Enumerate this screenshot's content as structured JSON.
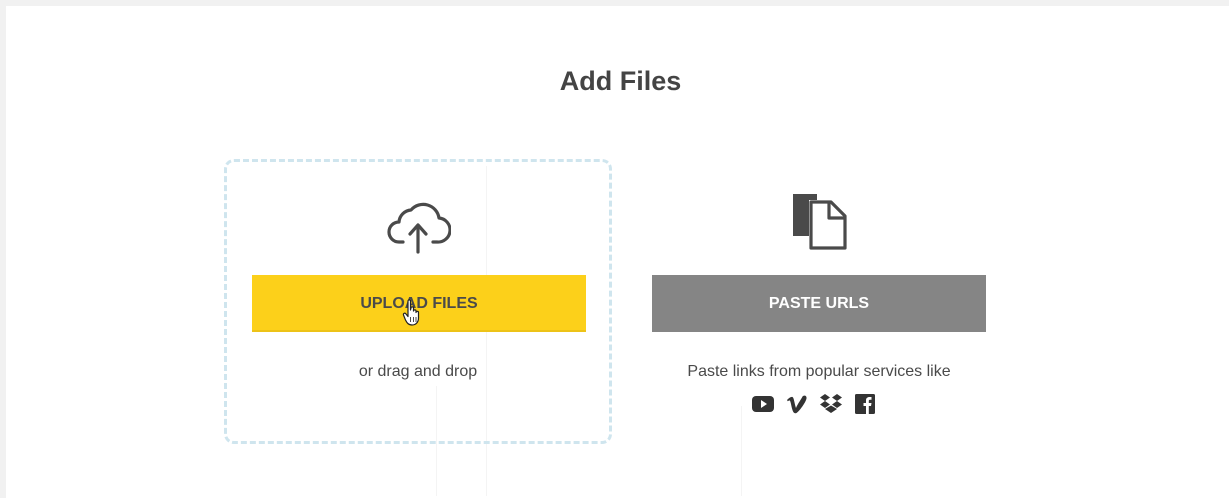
{
  "header": {
    "title": "Add Files"
  },
  "upload": {
    "button_label": "UPLOAD FILES",
    "drag_text": "or drag and drop",
    "icon": "cloud-upload-icon"
  },
  "paste": {
    "button_label": "PASTE URLS",
    "description": "Paste links from popular services like",
    "icon": "documents-icon",
    "services": [
      "youtube-icon",
      "vimeo-icon",
      "dropbox-icon",
      "facebook-icon"
    ]
  },
  "colors": {
    "upload_button": "#fcd01a",
    "paste_button": "#858585",
    "text": "#4a4a4a",
    "drop_border": "#cfe5ee"
  }
}
